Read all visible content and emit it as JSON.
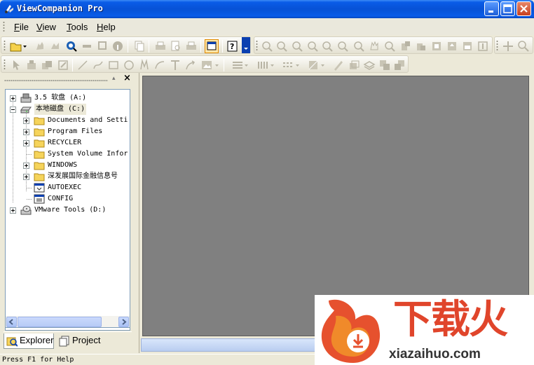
{
  "window": {
    "title": "ViewCompanion Pro",
    "titlebar_color": "#0a5ce8"
  },
  "menu": {
    "items": [
      {
        "label": "File",
        "mnemonic": "F",
        "rest": "ile"
      },
      {
        "label": "View",
        "mnemonic": "V",
        "rest": "iew"
      },
      {
        "label": "Tools",
        "mnemonic": "T",
        "rest": "ools"
      },
      {
        "label": "Help",
        "mnemonic": "H",
        "rest": "elp"
      }
    ]
  },
  "toolbar1": {
    "icons": [
      "open-folder-icon",
      "open-dropdown-icon",
      "hand-tool-icon",
      "hand-select-icon",
      "search-icon",
      "link-icon",
      "layers-icon",
      "info-icon",
      "copy-icon",
      "print-icon",
      "print-preview-icon",
      "print-setup-icon",
      "window-icon",
      "help-icon",
      "zoom-out-icon",
      "zoom-in-icon",
      "zoom-100-icon",
      "zoom-fit-icon",
      "zoom-width-icon",
      "zoom-height-icon",
      "zoom-window-icon",
      "pan-icon",
      "zoom-area-icon",
      "rotate-left-icon",
      "rotate-right-icon",
      "flip-icon",
      "mirror-icon",
      "page-icon",
      "page-2-icon",
      "move-icon",
      "find-icon"
    ]
  },
  "toolbar2": {
    "icons": [
      "select-arrow-icon",
      "markup-stamp-icon",
      "markup-group-icon",
      "markup-edit-icon",
      "line-icon",
      "freehand-icon",
      "rectangle-icon",
      "circle-icon",
      "polyline-icon",
      "arc-icon",
      "text-icon",
      "arrow-icon",
      "image-icon",
      "line-weight-icon",
      "line-style-icon",
      "dash-style-icon",
      "fill-icon",
      "pen-icon",
      "layer-icon",
      "stack-icon",
      "bring-front-icon",
      "send-back-icon"
    ]
  },
  "explorer": {
    "tree": [
      {
        "label": "3.5 软盘 (A:)",
        "icon": "floppy-drive-icon",
        "level": 0,
        "expander": "plus"
      },
      {
        "label": "本地磁盘 (C:)",
        "icon": "hard-drive-icon",
        "level": 0,
        "expander": "minus",
        "selected": true
      },
      {
        "label": "Documents and Setti",
        "icon": "folder-icon",
        "level": 1,
        "expander": "plus"
      },
      {
        "label": "Program Files",
        "icon": "folder-icon",
        "level": 1,
        "expander": "plus"
      },
      {
        "label": "RECYCLER",
        "icon": "folder-icon",
        "level": 1,
        "expander": "plus"
      },
      {
        "label": "System Volume Infor",
        "icon": "folder-icon",
        "level": 1,
        "expander": "none"
      },
      {
        "label": "WINDOWS",
        "icon": "folder-icon",
        "level": 1,
        "expander": "plus"
      },
      {
        "label": "深发展国际金融信息号",
        "icon": "folder-icon",
        "level": 1,
        "expander": "plus"
      },
      {
        "label": "AUTOEXEC",
        "icon": "bat-file-icon",
        "level": 1,
        "expander": "none"
      },
      {
        "label": "CONFIG",
        "icon": "config-file-icon",
        "level": 1,
        "expander": "none"
      },
      {
        "label": "VMware Tools (D:)",
        "icon": "cd-drive-icon",
        "level": 0,
        "expander": "plus"
      }
    ],
    "tabs": [
      {
        "label": "Explorer",
        "icon": "explorer-icon",
        "active": true
      },
      {
        "label": "Project",
        "icon": "project-icon",
        "active": false
      }
    ],
    "close_glyph": "×",
    "pin_glyph": "▴"
  },
  "status": {
    "text": "Press F1 for Help"
  },
  "watermark": {
    "chinese": "下载火",
    "url": "xiazaihuo.com",
    "color": "#e0452b"
  }
}
